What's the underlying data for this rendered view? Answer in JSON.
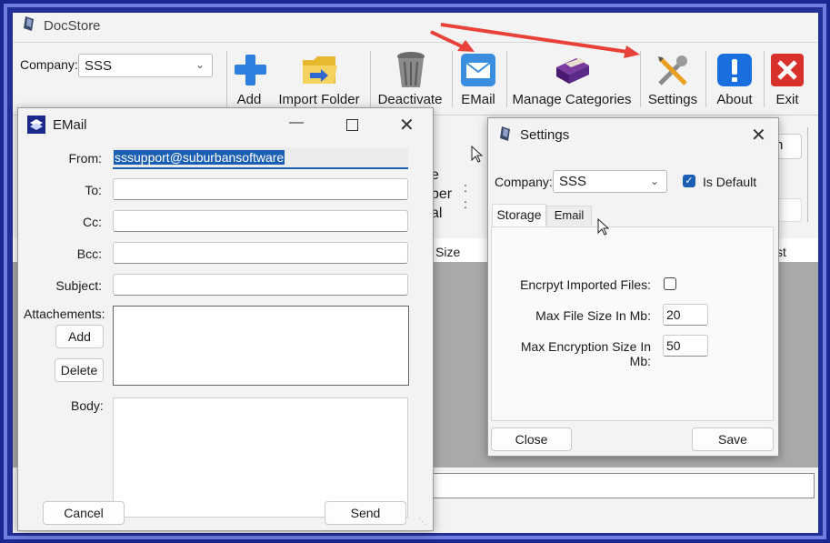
{
  "app": {
    "title": "DocStore",
    "company_label": "Company:",
    "company_value": "SSS"
  },
  "toolbar": {
    "add": "Add",
    "import_folder": "Import Folder",
    "deactivate": "Deactivate",
    "email": "EMail",
    "manage_categories": "Manage Categories",
    "settings": "Settings",
    "about": "About",
    "exit": "Exit"
  },
  "background": {
    "partial_button_text": "h",
    "partial_text_e": "e",
    "partial_text_ber": "ber",
    "partial_text_al": "al",
    "column_size": "Size",
    "column_st": "st",
    "partial_button_l": "l"
  },
  "email_dialog": {
    "title": "EMail",
    "from_label": "From:",
    "from_value": "sssupport@suburbansoftware",
    "to_label": "To:",
    "cc_label": "Cc:",
    "bcc_label": "Bcc:",
    "subject_label": "Subject:",
    "attachments_label": "Attachements:",
    "add_button": "Add",
    "delete_button": "Delete",
    "body_label": "Body:",
    "cancel_button": "Cancel",
    "send_button": "Send"
  },
  "settings_dialog": {
    "title": "Settings",
    "company_label": "Company:",
    "company_value": "SSS",
    "is_default_label": "Is Default",
    "is_default_checked": true,
    "tabs": [
      {
        "label": "Storage",
        "active": true
      },
      {
        "label": "Email",
        "active": false
      }
    ],
    "encrypt_label": "Encrpyt Imported Files:",
    "encrypt_checked": false,
    "max_file_size_label": "Max File Size In Mb:",
    "max_file_size_value": "20",
    "max_encryption_label": "Max Encryption Size In Mb:",
    "max_encryption_value": "50",
    "close_button": "Close",
    "save_button": "Save"
  },
  "annotations": {
    "arrow_color": "#e8413a"
  }
}
